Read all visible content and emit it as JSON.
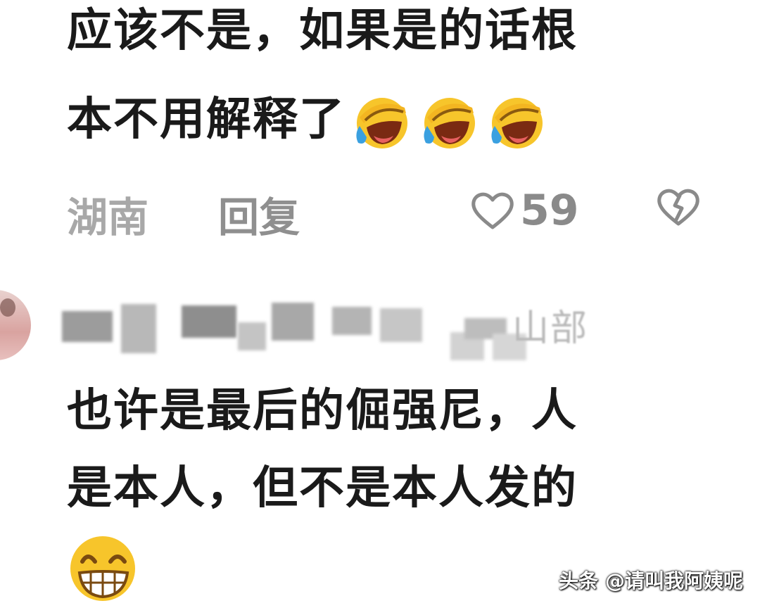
{
  "comments": [
    {
      "lines": [
        "应该不是，如果是的话根",
        "本不用解释了"
      ],
      "emoji": "face-with-tears-of-joy-icon",
      "location": "湖南",
      "reply_label": "回复",
      "like_count": "59"
    },
    {
      "username_visible": "山部",
      "lines": [
        "也许是最后的倔强尼，人",
        "是本人，但不是本人发的"
      ],
      "emoji": "grinning-face-icon"
    }
  ],
  "watermark": {
    "platform": "头条",
    "author": "@请叫我阿姨呢"
  },
  "colors": {
    "text": "#1a1a1a",
    "meta_gray": "#9a9a9a",
    "emoji_yellow": "#f7c52b",
    "tear_blue": "#3aa0e0"
  }
}
